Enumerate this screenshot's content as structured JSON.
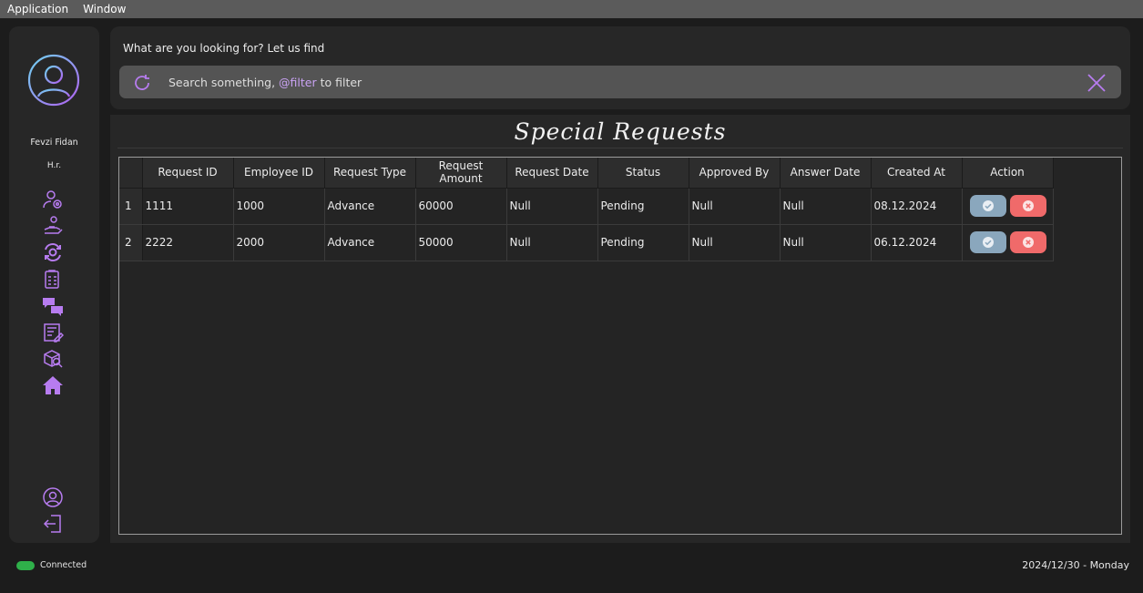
{
  "menu": {
    "items": [
      "Application",
      "Window"
    ]
  },
  "user": {
    "name": "Fevzi Fidan",
    "role": "H.r."
  },
  "sidebar": {
    "icons": [
      "user-settings-icon",
      "hand-user-icon",
      "sync-gear-icon",
      "document-checklist-icon",
      "chat-icon",
      "form-edit-icon",
      "box-search-icon",
      "home-icon"
    ],
    "bottom_icons": [
      "profile-icon",
      "logout-icon"
    ]
  },
  "search": {
    "prompt": "What are you looking for? Let us find",
    "placeholder_prefix": "Search something, ",
    "placeholder_filter": "@filter",
    "placeholder_suffix": " to filter"
  },
  "page": {
    "title": "Special Requests"
  },
  "table": {
    "columns": [
      "Request ID",
      "Employee ID",
      "Request Type",
      "Request Amount",
      "Request Date",
      "Status",
      "Approved By",
      "Answer Date",
      "Created At",
      "Action"
    ],
    "rows": [
      {
        "num": "1",
        "cells": [
          "1111",
          "1000",
          "Advance",
          "60000",
          "Null",
          "Pending",
          "Null",
          "Null",
          "08.12.2024"
        ]
      },
      {
        "num": "2",
        "cells": [
          "2222",
          "2000",
          "Advance",
          "50000",
          "Null",
          "Pending",
          "Null",
          "Null",
          "06.12.2024"
        ]
      }
    ]
  },
  "status": {
    "connection": "Connected",
    "date": "2024/12/30 - Monday"
  },
  "colors": {
    "accent": "#b77cf0",
    "approve": "#8aa7bd",
    "reject": "#f06a6a",
    "connected": "#2fb04a"
  }
}
